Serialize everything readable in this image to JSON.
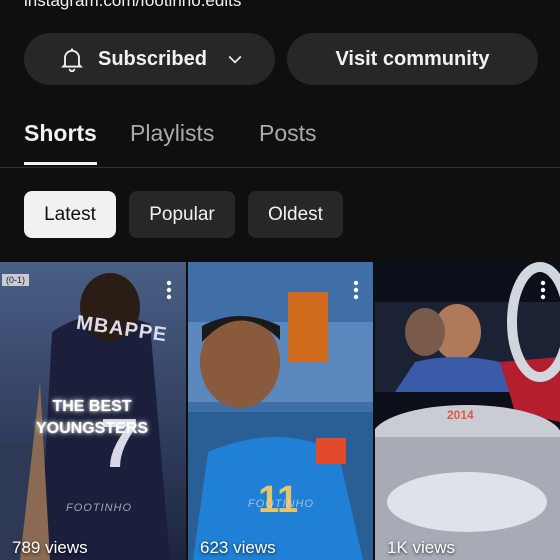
{
  "channel": {
    "link": "instagram.com/footinho.edits"
  },
  "actions": {
    "subscribed_label": "Subscribed",
    "visit_label": "Visit community"
  },
  "tabs": [
    {
      "label": "Shorts",
      "active": true
    },
    {
      "label": "Playlists",
      "active": false
    },
    {
      "label": "Posts",
      "active": false
    }
  ],
  "filters": [
    {
      "label": "Latest",
      "selected": true
    },
    {
      "label": "Popular",
      "selected": false
    },
    {
      "label": "Oldest",
      "selected": false
    }
  ],
  "shorts": [
    {
      "views": "789 views",
      "caption": "THE BEST YOUNGSTERS",
      "score_tag": "(0-1)",
      "jersey_name": "MBAPPE",
      "jersey_number": "7",
      "watermark": "FOOTINHO"
    },
    {
      "views": "623 views",
      "jersey_number": "11",
      "watermark": "FOOTINHO"
    },
    {
      "views": "1K views",
      "year_text": "2014"
    }
  ],
  "icons": {
    "bell": "bell-icon",
    "chevron": "chevron-down-icon",
    "more": "more-vert-icon"
  },
  "colors": {
    "background": "#0f0f0f",
    "button": "#272727",
    "text": "#f1f1f1",
    "muted": "#aaaaaa",
    "chip_selected": "#f1f1f1"
  }
}
